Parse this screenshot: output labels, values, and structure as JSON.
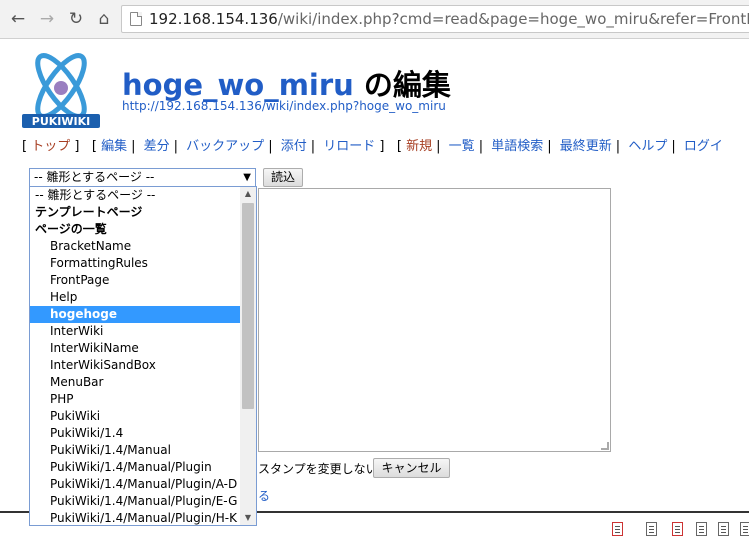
{
  "browser": {
    "url_host": "192.168.154.136",
    "url_path": "/wiki/index.php?cmd=read&page=hoge_wo_miru&refer=FrontPage"
  },
  "header": {
    "logo_text": "PUKIWIKI",
    "page_name": "hoge_wo_miru",
    "title_suffix": " の編集",
    "page_url": "http://192.168.154.136/wiki/index.php?hoge_wo_miru"
  },
  "menu": {
    "open1": "[",
    "top": "トップ",
    "close1": "]",
    "open2": "[",
    "edit": "編集",
    "diff": "差分",
    "backup": "バックアップ",
    "attach": "添付",
    "reload": "リロード",
    "close2": "]",
    "open3": "[",
    "new": "新規",
    "list": "一覧",
    "search": "単語検索",
    "recent": "最終更新",
    "help": "ヘルプ",
    "login": "ログイ"
  },
  "form": {
    "template_select_value": "-- 雛形とするページ --",
    "load_button": "読込",
    "timestamp_label": "スタンプを変更しない",
    "cancel_button": "キャンセル",
    "fragment_link": "る"
  },
  "dropdown": {
    "items": [
      {
        "label": "-- 雛形とするページ --",
        "kind": "top"
      },
      {
        "label": "テンプレートページ",
        "kind": "group"
      },
      {
        "label": "ページの一覧",
        "kind": "group"
      },
      {
        "label": "BracketName",
        "kind": "opt"
      },
      {
        "label": "FormattingRules",
        "kind": "opt"
      },
      {
        "label": "FrontPage",
        "kind": "opt"
      },
      {
        "label": "Help",
        "kind": "opt"
      },
      {
        "label": "hogehoge",
        "kind": "opt",
        "selected": true
      },
      {
        "label": "InterWiki",
        "kind": "opt"
      },
      {
        "label": "InterWikiName",
        "kind": "opt"
      },
      {
        "label": "InterWikiSandBox",
        "kind": "opt"
      },
      {
        "label": "MenuBar",
        "kind": "opt"
      },
      {
        "label": "PHP",
        "kind": "opt"
      },
      {
        "label": "PukiWiki",
        "kind": "opt"
      },
      {
        "label": "PukiWiki/1.4",
        "kind": "opt"
      },
      {
        "label": "PukiWiki/1.4/Manual",
        "kind": "opt"
      },
      {
        "label": "PukiWiki/1.4/Manual/Plugin",
        "kind": "opt"
      },
      {
        "label": "PukiWiki/1.4/Manual/Plugin/A-D",
        "kind": "opt"
      },
      {
        "label": "PukiWiki/1.4/Manual/Plugin/E-G",
        "kind": "opt"
      },
      {
        "label": "PukiWiki/1.4/Manual/Plugin/H-K",
        "kind": "opt"
      }
    ]
  },
  "colors": {
    "link": "#215dc6",
    "visited": "#a63d21",
    "selection": "#3399ff"
  }
}
